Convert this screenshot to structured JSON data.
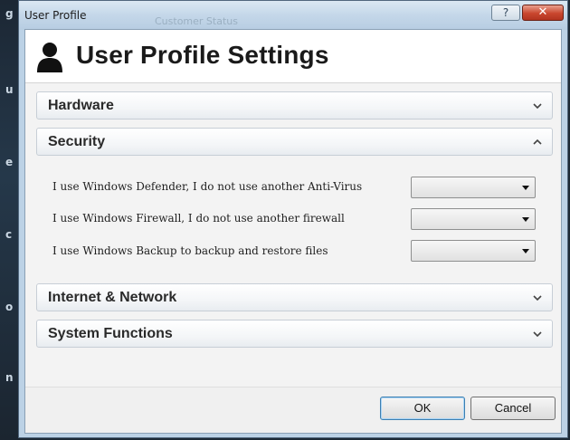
{
  "window": {
    "title": "User Profile",
    "ghost_title": "Customer Status",
    "help_label": "?",
    "close_label": "✕"
  },
  "header": {
    "title": "User Profile Settings",
    "icon": "user-icon"
  },
  "desktop_fragments": [
    "g",
    "u",
    "e",
    "c",
    "o",
    "n"
  ],
  "sections": [
    {
      "label": "Hardware",
      "state": "collapsed"
    },
    {
      "label": "Security",
      "state": "expanded"
    },
    {
      "label": "Internet & Network",
      "state": "collapsed"
    },
    {
      "label": "System Functions",
      "state": "collapsed"
    }
  ],
  "security_items": [
    {
      "label": "I use Windows Defender, I do not use another Anti-Virus",
      "value": ""
    },
    {
      "label": "I use Windows Firewall, I do not use another firewall",
      "value": ""
    },
    {
      "label": "I use Windows Backup to backup and restore files",
      "value": ""
    }
  ],
  "footer": {
    "ok_label": "OK",
    "cancel_label": "Cancel"
  },
  "colors": {
    "title_bar": "#c4d7e9",
    "close_button": "#c9462e",
    "ok_focus": "#3c7fb1"
  }
}
